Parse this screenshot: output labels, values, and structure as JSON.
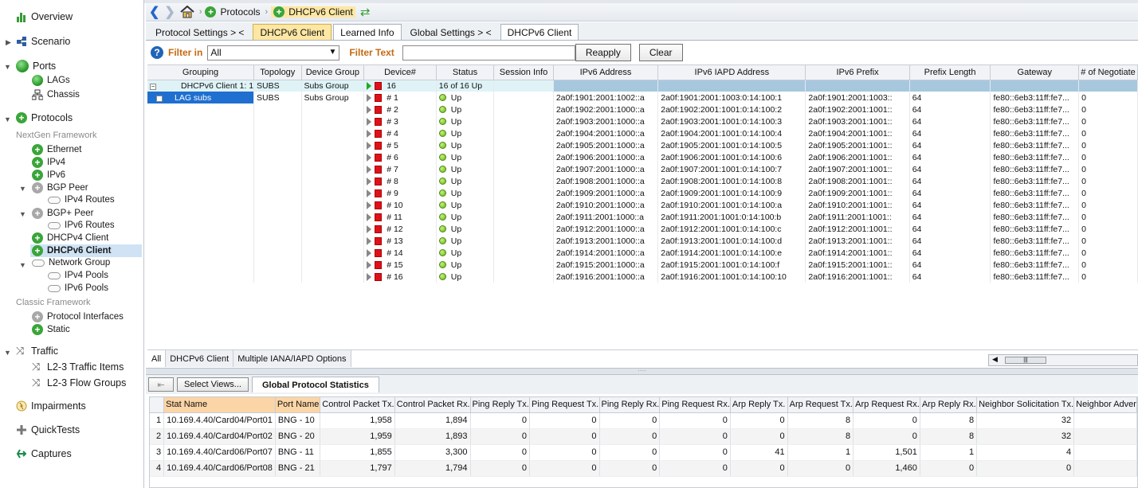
{
  "sidebar": {
    "overview": "Overview",
    "scenario": "Scenario",
    "ports": "Ports",
    "lags": "LAGs",
    "chassis": "Chassis",
    "protocols": "Protocols",
    "nextgen": "NextGen Framework",
    "ethernet": "Ethernet",
    "ipv4": "IPv4",
    "ipv6": "IPv6",
    "bgp_peer": "BGP Peer",
    "ipv4_routes": "IPv4 Routes",
    "bgpplus_peer": "BGP+ Peer",
    "ipv6_routes": "IPv6 Routes",
    "dhcpv4": "DHCPv4 Client",
    "dhcpv6": "DHCPv6 Client",
    "network_group": "Network Group",
    "ipv4_pools": "IPv4 Pools",
    "ipv6_pools": "IPv6 Pools",
    "classic": "Classic Framework",
    "protocol_interfaces": "Protocol Interfaces",
    "static": "Static",
    "traffic": "Traffic",
    "l23_traffic": "L2-3 Traffic Items",
    "l23_flow": "L2-3 Flow Groups",
    "impairments": "Impairments",
    "quicktests": "QuickTests",
    "captures": "Captures"
  },
  "breadcrumb": {
    "protocols": "Protocols",
    "dhcpv6": "DHCPv6 Client"
  },
  "tabs": {
    "protocol_settings": "Protocol Settings",
    "dhcpv6_client": "DHCPv6 Client",
    "learned_info": "Learned Info",
    "global_settings": "Global Settings",
    "dhcpv6_client2": "DHCPv6 Client"
  },
  "filter": {
    "label": "Filter in",
    "value": "All",
    "text_label": "Filter Text",
    "reapply": "Reapply",
    "clear": "Clear"
  },
  "grid": {
    "columns": [
      "Grouping",
      "Topology",
      "Device Group",
      "Device#",
      "Status",
      "Session Info",
      "IPv6 Address",
      "IPv6 IAPD Address",
      "IPv6 Prefix",
      "Prefix Length",
      "Gateway",
      "# of Negotiate"
    ],
    "group_row": {
      "grouping": "DHCPv6 Client 1: 1",
      "topology": "SUBS",
      "device_group": "Subs Group",
      "device": "16",
      "status": "16 of 16 Up"
    },
    "lag_row": {
      "grouping": "LAG subs",
      "topology": "SUBS",
      "device_group": "Subs Group"
    },
    "rows": [
      {
        "dev": "# 1",
        "status": "Up",
        "ipv6": "2a0f:1901:2001:1002::a",
        "iapd": "2a0f:1901:2001:1003:0:14:100:1",
        "prefix": "2a0f:1901:2001:1003::",
        "plen": "64",
        "gw": "fe80::6eb3:11ff:fe7...",
        "neg": "0"
      },
      {
        "dev": "# 2",
        "status": "Up",
        "ipv6": "2a0f:1902:2001:1000::a",
        "iapd": "2a0f:1902:2001:1001:0:14:100:2",
        "prefix": "2a0f:1902:2001:1001::",
        "plen": "64",
        "gw": "fe80::6eb3:11ff:fe7...",
        "neg": "0"
      },
      {
        "dev": "# 3",
        "status": "Up",
        "ipv6": "2a0f:1903:2001:1000::a",
        "iapd": "2a0f:1903:2001:1001:0:14:100:3",
        "prefix": "2a0f:1903:2001:1001::",
        "plen": "64",
        "gw": "fe80::6eb3:11ff:fe7...",
        "neg": "0"
      },
      {
        "dev": "# 4",
        "status": "Up",
        "ipv6": "2a0f:1904:2001:1000::a",
        "iapd": "2a0f:1904:2001:1001:0:14:100:4",
        "prefix": "2a0f:1904:2001:1001::",
        "plen": "64",
        "gw": "fe80::6eb3:11ff:fe7...",
        "neg": "0"
      },
      {
        "dev": "# 5",
        "status": "Up",
        "ipv6": "2a0f:1905:2001:1000::a",
        "iapd": "2a0f:1905:2001:1001:0:14:100:5",
        "prefix": "2a0f:1905:2001:1001::",
        "plen": "64",
        "gw": "fe80::6eb3:11ff:fe7...",
        "neg": "0"
      },
      {
        "dev": "# 6",
        "status": "Up",
        "ipv6": "2a0f:1906:2001:1000::a",
        "iapd": "2a0f:1906:2001:1001:0:14:100:6",
        "prefix": "2a0f:1906:2001:1001::",
        "plen": "64",
        "gw": "fe80::6eb3:11ff:fe7...",
        "neg": "0"
      },
      {
        "dev": "# 7",
        "status": "Up",
        "ipv6": "2a0f:1907:2001:1000::a",
        "iapd": "2a0f:1907:2001:1001:0:14:100:7",
        "prefix": "2a0f:1907:2001:1001::",
        "plen": "64",
        "gw": "fe80::6eb3:11ff:fe7...",
        "neg": "0"
      },
      {
        "dev": "# 8",
        "status": "Up",
        "ipv6": "2a0f:1908:2001:1000::a",
        "iapd": "2a0f:1908:2001:1001:0:14:100:8",
        "prefix": "2a0f:1908:2001:1001::",
        "plen": "64",
        "gw": "fe80::6eb3:11ff:fe7...",
        "neg": "0"
      },
      {
        "dev": "# 9",
        "status": "Up",
        "ipv6": "2a0f:1909:2001:1000::a",
        "iapd": "2a0f:1909:2001:1001:0:14:100:9",
        "prefix": "2a0f:1909:2001:1001::",
        "plen": "64",
        "gw": "fe80::6eb3:11ff:fe7...",
        "neg": "0"
      },
      {
        "dev": "# 10",
        "status": "Up",
        "ipv6": "2a0f:1910:2001:1000::a",
        "iapd": "2a0f:1910:2001:1001:0:14:100:a",
        "prefix": "2a0f:1910:2001:1001::",
        "plen": "64",
        "gw": "fe80::6eb3:11ff:fe7...",
        "neg": "0"
      },
      {
        "dev": "# 11",
        "status": "Up",
        "ipv6": "2a0f:1911:2001:1000::a",
        "iapd": "2a0f:1911:2001:1001:0:14:100:b",
        "prefix": "2a0f:1911:2001:1001::",
        "plen": "64",
        "gw": "fe80::6eb3:11ff:fe7...",
        "neg": "0"
      },
      {
        "dev": "# 12",
        "status": "Up",
        "ipv6": "2a0f:1912:2001:1000::a",
        "iapd": "2a0f:1912:2001:1001:0:14:100:c",
        "prefix": "2a0f:1912:2001:1001::",
        "plen": "64",
        "gw": "fe80::6eb3:11ff:fe7...",
        "neg": "0"
      },
      {
        "dev": "# 13",
        "status": "Up",
        "ipv6": "2a0f:1913:2001:1000::a",
        "iapd": "2a0f:1913:2001:1001:0:14:100:d",
        "prefix": "2a0f:1913:2001:1001::",
        "plen": "64",
        "gw": "fe80::6eb3:11ff:fe7...",
        "neg": "0"
      },
      {
        "dev": "# 14",
        "status": "Up",
        "ipv6": "2a0f:1914:2001:1000::a",
        "iapd": "2a0f:1914:2001:1001:0:14:100:e",
        "prefix": "2a0f:1914:2001:1001::",
        "plen": "64",
        "gw": "fe80::6eb3:11ff:fe7...",
        "neg": "0"
      },
      {
        "dev": "# 15",
        "status": "Up",
        "ipv6": "2a0f:1915:2001:1000::a",
        "iapd": "2a0f:1915:2001:1001:0:14:100:f",
        "prefix": "2a0f:1915:2001:1001::",
        "plen": "64",
        "gw": "fe80::6eb3:11ff:fe7...",
        "neg": "0"
      },
      {
        "dev": "# 16",
        "status": "Up",
        "ipv6": "2a0f:1916:2001:1000::a",
        "iapd": "2a0f:1916:2001:1001:0:14:100:10",
        "prefix": "2a0f:1916:2001:1001::",
        "plen": "64",
        "gw": "fe80::6eb3:11ff:fe7...",
        "neg": "0"
      }
    ]
  },
  "subtabs": {
    "all": "All",
    "dhcpv6": "DHCPv6 Client",
    "multiple": "Multiple IANA/IAPD Options"
  },
  "bottom": {
    "select_views": "Select Views...",
    "global_tab": "Global Protocol Statistics"
  },
  "stats": {
    "columns": [
      "Stat Name",
      "Port Name",
      "Control Packet Tx.",
      "Control Packet Rx.",
      "Ping Reply Tx.",
      "Ping Request Tx.",
      "Ping Reply Rx.",
      "Ping Request Rx.",
      "Arp Reply Tx.",
      "Arp Request Tx.",
      "Arp Request Rx.",
      "Arp Reply Rx.",
      "Neighbor Solicitation Tx.",
      "Neighbor Adver"
    ],
    "rows": [
      {
        "idx": "1",
        "stat": "10.169.4.40/Card04/Port01",
        "port": "BNG - 10",
        "v": [
          "1,958",
          "1,894",
          "0",
          "0",
          "0",
          "0",
          "0",
          "8",
          "0",
          "8",
          "32"
        ]
      },
      {
        "idx": "2",
        "stat": "10.169.4.40/Card04/Port02",
        "port": "BNG - 20",
        "v": [
          "1,959",
          "1,893",
          "0",
          "0",
          "0",
          "0",
          "0",
          "8",
          "0",
          "8",
          "32"
        ]
      },
      {
        "idx": "3",
        "stat": "10.169.4.40/Card06/Port07",
        "port": "BNG - 11",
        "v": [
          "1,855",
          "3,300",
          "0",
          "0",
          "0",
          "0",
          "41",
          "1",
          "1,501",
          "1",
          "4"
        ]
      },
      {
        "idx": "4",
        "stat": "10.169.4.40/Card06/Port08",
        "port": "BNG - 21",
        "v": [
          "1,797",
          "1,794",
          "0",
          "0",
          "0",
          "0",
          "0",
          "0",
          "1,460",
          "0",
          "0"
        ]
      }
    ]
  }
}
